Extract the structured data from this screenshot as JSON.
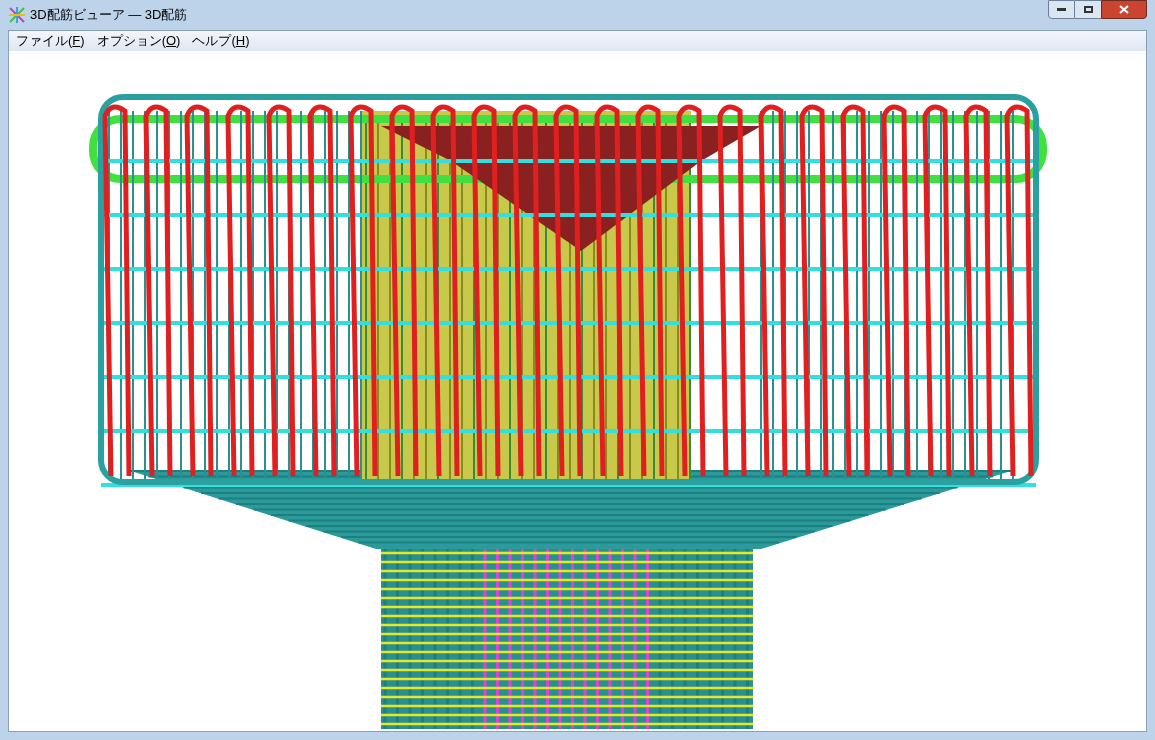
{
  "window": {
    "title": "3D配筋ビューア ― 3D配筋"
  },
  "menu": [
    {
      "before": "ファイル(",
      "key": "F",
      "after": ")"
    },
    {
      "before": "オプション(",
      "key": "O",
      "after": ")"
    },
    {
      "before": "ヘルプ(",
      "key": "H",
      "after": ")"
    }
  ]
}
